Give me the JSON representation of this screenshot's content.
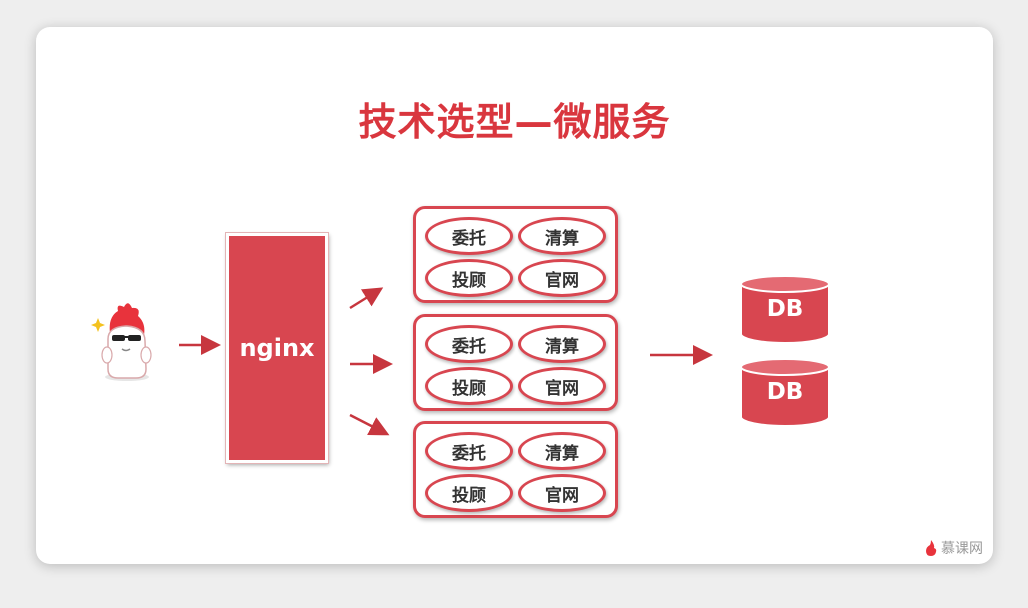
{
  "title": "技术选型—微服务",
  "nginx": {
    "label": "nginx"
  },
  "service_groups": [
    {
      "items": [
        "委托",
        "清算",
        "投顾",
        "官网"
      ]
    },
    {
      "items": [
        "委托",
        "清算",
        "投顾",
        "官网"
      ]
    },
    {
      "items": [
        "委托",
        "清算",
        "投顾",
        "官网"
      ]
    }
  ],
  "databases": [
    {
      "label": "DB"
    },
    {
      "label": "DB"
    }
  ],
  "icons": {
    "user": "cartoon-mascot-icon",
    "logo_flame": "flame-icon"
  },
  "colors": {
    "accent": "#d84650",
    "title": "#d9363e",
    "arrow": "#c7363e"
  },
  "watermark": {
    "text": "慕课网"
  }
}
